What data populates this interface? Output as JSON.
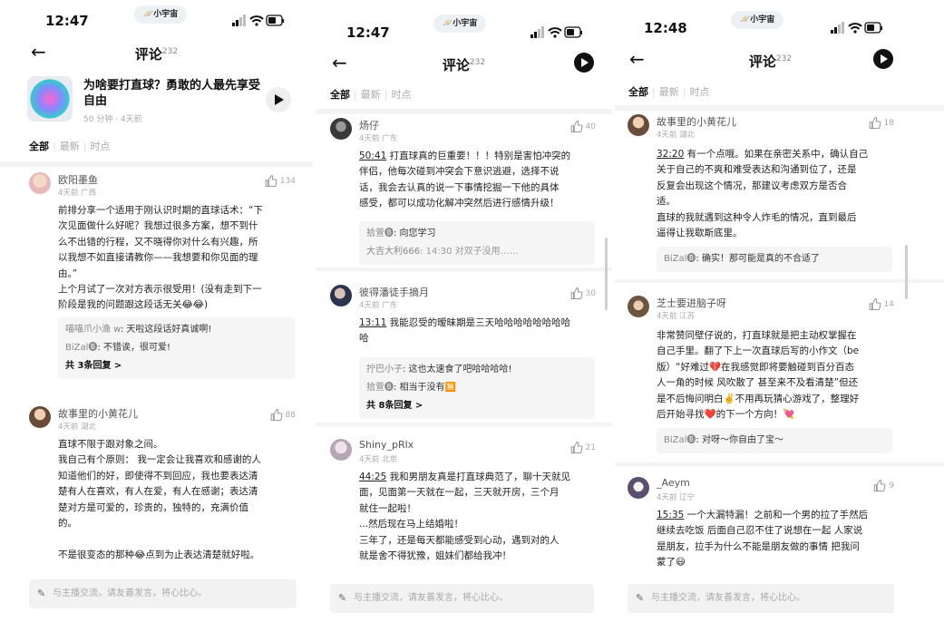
{
  "phones": [
    {
      "status": {
        "time": "12:47",
        "pill": "🪐小宇宙"
      },
      "title": "评论",
      "count": "232",
      "episode": {
        "title": "为啥要打直球？勇敢的人最先享受自由",
        "meta": "50 分钟 · 4天前"
      },
      "tabs": [
        "全部",
        "最新",
        "时点"
      ],
      "comments": [
        {
          "name": "欧阳墨鱼",
          "meta": "4天前  广西",
          "likes": "134",
          "lines": [
            "前排分享一个适用于刚认识时期的直球话术：“下",
            "次见面做什么好呢？我想过很多方案，想不到什",
            "么不出错的行程，又不晓得你对什么有兴趣，所",
            "以我想不如直接请教你——我想要和你见面的理",
            "由。”",
            "上个月试了一次对方表示很受用！(没有走到下一",
            "阶段是我的问题跟这段话无关😂😂)"
          ],
          "replies": [
            {
              "who": "喵喵爪小渔 w",
              "text": ": 天啦这段话好真诚啊!"
            },
            {
              "who": "BiZal🅑",
              "text": ": 不错诶，很可爱!"
            }
          ],
          "more": "共 3条回复 >"
        },
        {
          "name": "故事里的小黄花儿",
          "meta": "4天前  湖北",
          "likes": "88",
          "lines": [
            "直球不限于跟对象之间。",
            "我自己有个原则： 我一定会让我喜欢和感谢的人",
            "知道他们的好，即使得不到回应，我也要表达清",
            "楚有人在喜欢，有人在爱，有人在感谢；表达清",
            "楚对方是可爱的，珍贵的，独特的，充满价值",
            "的。",
            "",
            "不是很变态的那种😂点到为止表达清楚就好啦。"
          ]
        }
      ],
      "composer": "与主播交流，请友善发言，将心比心。"
    },
    {
      "status": {
        "time": "12:47",
        "pill": "🪐小宇宙"
      },
      "title": "评论",
      "count": "232",
      "tabs": [
        "全部",
        "最新",
        "时点"
      ],
      "comments": [
        {
          "name": "炀仔",
          "meta": "4天前  广东",
          "likes": "40",
          "ts": "50:41",
          "lines": [
            " 打直球真的巨重要！！！特别是害怕冲突的",
            "伴侣，他每次碰到冲突会下意识逃避，选择不说",
            "话，我会去认真的说一下事情挖掘一下他的具体",
            "感受，都可以成功化解冲突然后进行感情升级！"
          ],
          "replies": [
            {
              "who": "拾萱🅑",
              "text": ": 向您学习"
            },
            {
              "who": "大吉大利666",
              "text": ": 14:30 对双子没用……"
            }
          ]
        },
        {
          "name": "彼得潘徒手摘月",
          "meta": "4天前  广东",
          "likes": "30",
          "ts": "13:11",
          "lines": [
            " 我能忍受的暧昧期是三天哈哈哈哈哈哈哈哈",
            "哈"
          ],
          "replies": [
            {
              "who": "拧巴小子",
              "text": ": 这也太速食了吧哈哈哈哈!"
            },
            {
              "who": "拾萱🅑",
              "text": ": 相当于没有🈚"
            }
          ],
          "more": "共 8条回复 >"
        },
        {
          "name": "Shiny_pRlx",
          "meta": "4天前  北京",
          "likes": "21",
          "ts": "44:25",
          "lines": [
            " 我和男朋友真是打直球典范了，聊十天就见",
            "面，见面第一天就在一起，三天就开房，三个月",
            "就住一起啦！",
            "...然后现在马上结婚啦！",
            "三年了，还是每天都能感受到心动，遇到对的人",
            "就是舍不得犹豫，姐妹们都给我冲！"
          ]
        }
      ],
      "composer": "与主播交流，请友善发言，将心比心。"
    },
    {
      "status": {
        "time": "12:48",
        "pill": "🪐小宇宙"
      },
      "title": "评论",
      "count": "232",
      "tabs": [
        "全部",
        "最新",
        "时点"
      ],
      "comments": [
        {
          "name": "故事里的小黄花儿",
          "meta": "4天前  湖北",
          "likes": "18",
          "ts": "32:20",
          "lines": [
            " 有一个点哦。如果在亲密关系中，确认自己",
            "关于自己的不爽和难受表达和沟通到位了，还是",
            "反复会出现这个情况，那建议考虑双方是否合",
            "适。",
            "直球的我就遇到这种令人炸毛的情况，直到最后",
            "逼得让我歇斯底里。"
          ],
          "replies": [
            {
              "who": "BiZal🅑",
              "text": ": 确实！那可能是真的不合适了"
            }
          ]
        },
        {
          "name": "芝士要进脑子呀",
          "meta": "4天前  江苏",
          "likes": "14",
          "lines": [
            "非常赞同壁仔说的，打直球就是把主动权掌握在",
            "自己手里。翻了下上一次直球后写的小作文（be",
            "版）“好难过💔在我感觉即将要触碰到百分百态",
            "人一角的时候 风吹散了 甚至来不及看清楚”但还",
            "是不后悔问明白✌️不用再玩猜心游戏了，整理好",
            "后开始寻找❤️的下一个方向！💘"
          ],
          "replies": [
            {
              "who": "BiZal🅑",
              "text": ": 对呀～你自由了宝～"
            }
          ]
        },
        {
          "name": "_Aeym",
          "meta": "4天前  辽宁",
          "likes": "9",
          "ts": "15:35",
          "lines": [
            " 一个大漏特漏！之前和一个男的拉了手然后",
            "继续去吃饭 后面自己忍不住了说想在一起 人家说",
            "是朋友，拉手为什么不能是朋友做的事情 把我问",
            "蒙了😃"
          ]
        }
      ],
      "composer": "与主播交流，请友善发言，将心比心。"
    }
  ]
}
